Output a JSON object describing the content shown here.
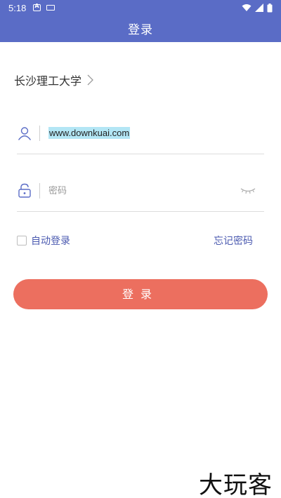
{
  "status_bar": {
    "time": "5:18"
  },
  "header": {
    "title": "登录"
  },
  "school": {
    "name": "长沙理工大学"
  },
  "username": {
    "value": "www.downkuai.com"
  },
  "password": {
    "placeholder": "密码"
  },
  "options": {
    "auto_login_label": "自动登录",
    "forgot_password_label": "忘记密码"
  },
  "login_button": {
    "label": "登录"
  },
  "watermark": {
    "text": "大玩客"
  },
  "colors": {
    "header_bg": "#5a6cc6",
    "button_bg": "#ec6f5f",
    "link": "#4b5ab0",
    "icon": "#5a6cc6"
  }
}
